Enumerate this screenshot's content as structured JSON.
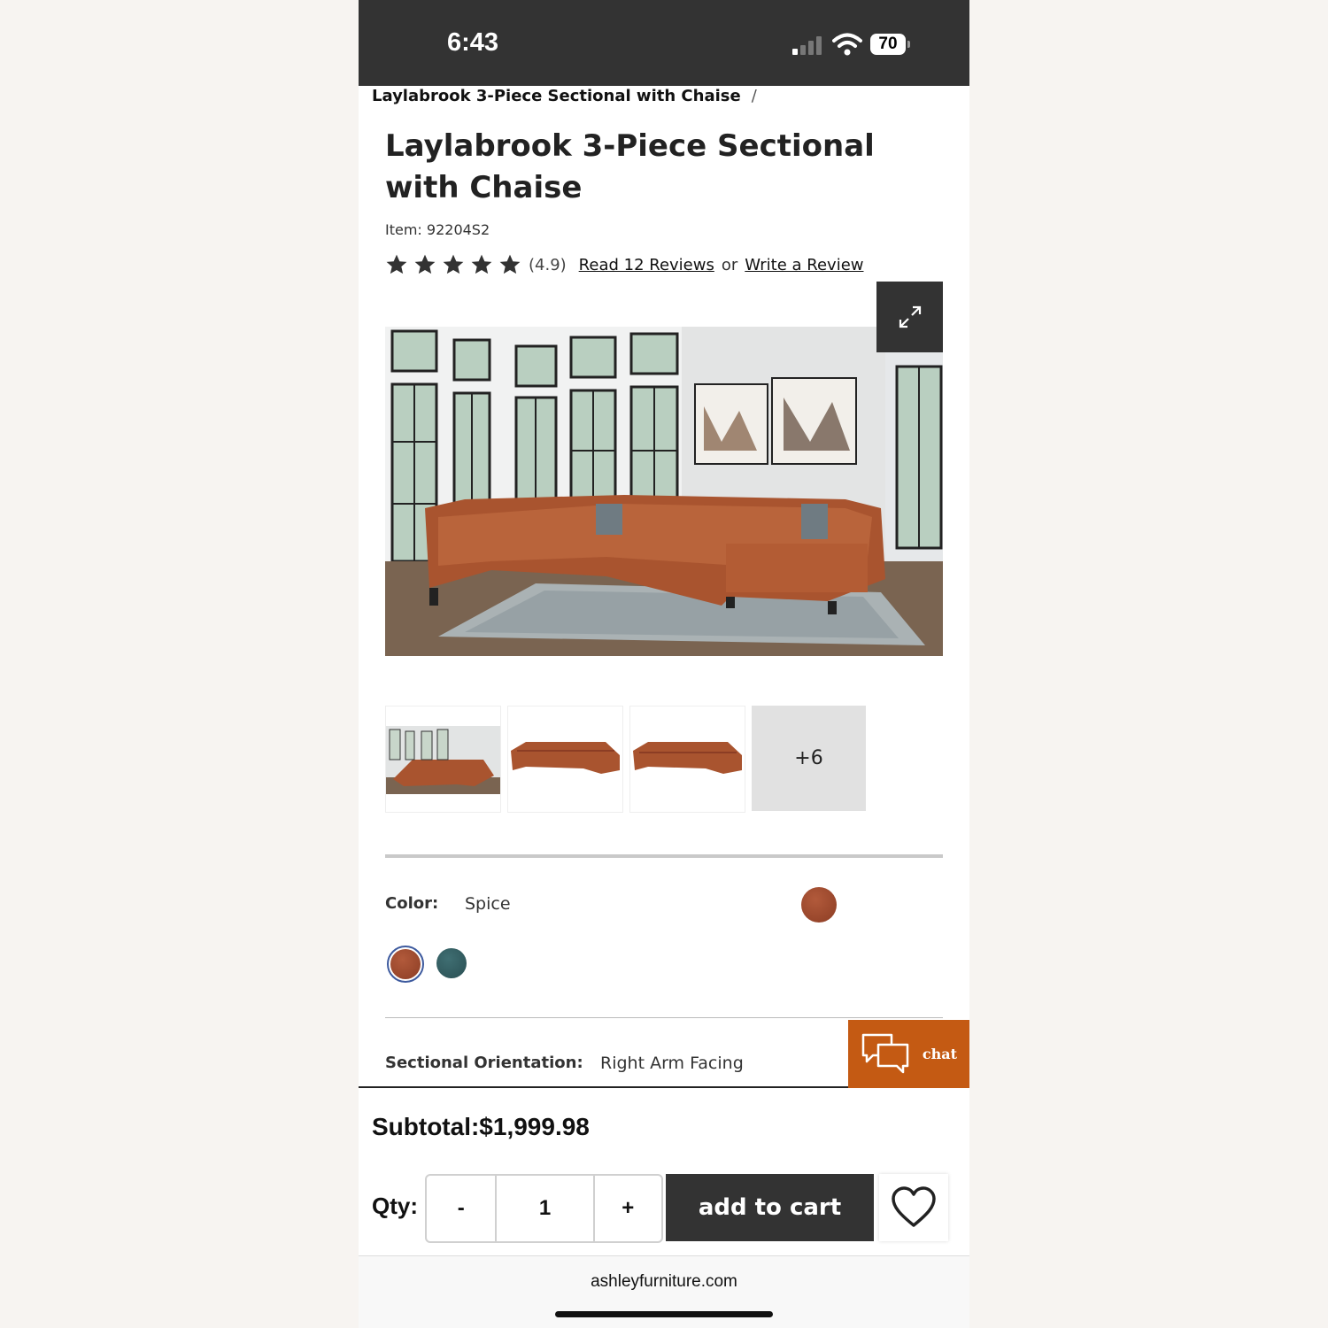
{
  "status_bar": {
    "time": "6:43",
    "battery": "70"
  },
  "breadcrumb": {
    "current": "Laylabrook 3-Piece Sectional with Chaise",
    "separator": "/"
  },
  "product": {
    "title": "Laylabrook 3-Piece Sectional with Chaise",
    "item_number": "Item: 92204S2",
    "rating": 4.9,
    "rating_text": "(4.9)",
    "stars": 5,
    "read_reviews": "Read 12 Reviews",
    "or_text": "or",
    "write_review": "Write a Review"
  },
  "gallery": {
    "more_count": "+6"
  },
  "options": {
    "color_label": "Color:",
    "color_value": "Spice",
    "swatches": [
      {
        "name": "Spice",
        "color": "#9a4428",
        "selected": true
      },
      {
        "name": "Teal",
        "color": "#2e5a5e",
        "selected": false
      }
    ],
    "orientation_label": "Sectional Orientation:",
    "orientation_value": "Right Arm Facing"
  },
  "chat": {
    "label": "chat",
    "color": "#c45a13"
  },
  "cart": {
    "subtotal": "Subtotal:$1,999.98",
    "qty_label": "Qty:",
    "minus": "-",
    "qty": "1",
    "plus": "+",
    "add_to_cart": "add to cart"
  },
  "browser": {
    "url": "ashleyfurniture.com"
  }
}
